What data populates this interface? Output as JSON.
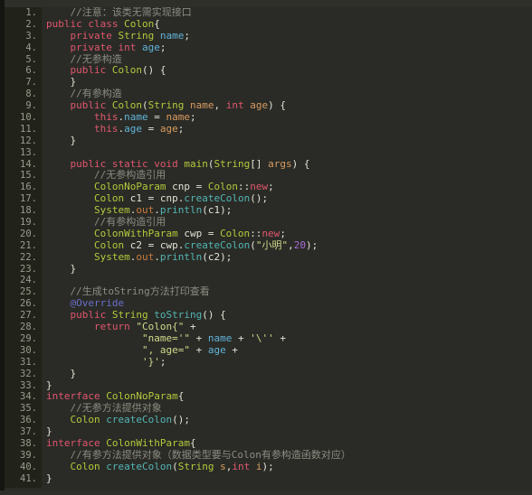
{
  "editor": {
    "name": "java-code-editor",
    "background": "#2a2b26",
    "gutter_background": "#212219",
    "line_count": 41,
    "language": "Java",
    "colors": {
      "keyword": "#e0566e",
      "class_name": "#b5c83c",
      "field": "#62b4da",
      "parameter": "#d79b60",
      "string": "#d2d98c",
      "number": "#a96ed6",
      "method": "#54b5b5",
      "comment": "#8c8c82",
      "annotation": "#6a6fcb",
      "static_field": "#c97a3e",
      "default_text": "#e2e2d6"
    }
  },
  "line_numbers": [
    "1.",
    "2.",
    "3.",
    "4.",
    "5.",
    "6.",
    "7.",
    "8.",
    "9.",
    "10.",
    "11.",
    "12.",
    "13.",
    "14.",
    "15.",
    "16.",
    "17.",
    "18.",
    "19.",
    "20.",
    "21.",
    "22.",
    "23.",
    "24.",
    "25.",
    "26.",
    "27.",
    "28.",
    "29.",
    "30.",
    "31.",
    "32.",
    "33.",
    "34.",
    "35.",
    "36.",
    "37.",
    "38.",
    "39.",
    "40.",
    "41."
  ],
  "lines": [
    {
      "n": 1,
      "tokens": [
        {
          "t": "    ",
          "c": "def"
        },
        {
          "t": "//注意：该类无需实现接口",
          "c": "cmt"
        }
      ]
    },
    {
      "n": 2,
      "tokens": [
        {
          "t": "",
          "c": "def"
        },
        {
          "t": "public ",
          "c": "kw"
        },
        {
          "t": "class ",
          "c": "kw"
        },
        {
          "t": "Colon",
          "c": "cls"
        },
        {
          "t": "{",
          "c": "punc"
        }
      ]
    },
    {
      "n": 3,
      "tokens": [
        {
          "t": "    ",
          "c": "def"
        },
        {
          "t": "private ",
          "c": "kw"
        },
        {
          "t": "String",
          "c": "cls"
        },
        {
          "t": " ",
          "c": "def"
        },
        {
          "t": "name",
          "c": "fld"
        },
        {
          "t": ";",
          "c": "punc"
        }
      ]
    },
    {
      "n": 4,
      "tokens": [
        {
          "t": "    ",
          "c": "def"
        },
        {
          "t": "private ",
          "c": "kw"
        },
        {
          "t": "int",
          "c": "kw"
        },
        {
          "t": " ",
          "c": "def"
        },
        {
          "t": "age",
          "c": "fld"
        },
        {
          "t": ";",
          "c": "punc"
        }
      ]
    },
    {
      "n": 5,
      "tokens": [
        {
          "t": "    ",
          "c": "def"
        },
        {
          "t": "//无参构造",
          "c": "cmt"
        }
      ]
    },
    {
      "n": 6,
      "tokens": [
        {
          "t": "    ",
          "c": "def"
        },
        {
          "t": "public ",
          "c": "kw"
        },
        {
          "t": "Colon",
          "c": "cls"
        },
        {
          "t": "() {",
          "c": "punc"
        }
      ]
    },
    {
      "n": 7,
      "tokens": [
        {
          "t": "    }",
          "c": "punc"
        }
      ]
    },
    {
      "n": 8,
      "tokens": [
        {
          "t": "    ",
          "c": "def"
        },
        {
          "t": "//有参构造",
          "c": "cmt"
        }
      ]
    },
    {
      "n": 9,
      "tokens": [
        {
          "t": "    ",
          "c": "def"
        },
        {
          "t": "public ",
          "c": "kw"
        },
        {
          "t": "Colon",
          "c": "cls"
        },
        {
          "t": "(",
          "c": "punc"
        },
        {
          "t": "String",
          "c": "cls"
        },
        {
          "t": " ",
          "c": "def"
        },
        {
          "t": "name",
          "c": "par"
        },
        {
          "t": ", ",
          "c": "punc"
        },
        {
          "t": "int",
          "c": "kw"
        },
        {
          "t": " ",
          "c": "def"
        },
        {
          "t": "age",
          "c": "par"
        },
        {
          "t": ") {",
          "c": "punc"
        }
      ]
    },
    {
      "n": 10,
      "tokens": [
        {
          "t": "        ",
          "c": "def"
        },
        {
          "t": "this",
          "c": "kw"
        },
        {
          "t": ".",
          "c": "punc"
        },
        {
          "t": "name",
          "c": "fld"
        },
        {
          "t": " = ",
          "c": "punc"
        },
        {
          "t": "name",
          "c": "par"
        },
        {
          "t": ";",
          "c": "punc"
        }
      ]
    },
    {
      "n": 11,
      "tokens": [
        {
          "t": "        ",
          "c": "def"
        },
        {
          "t": "this",
          "c": "kw"
        },
        {
          "t": ".",
          "c": "punc"
        },
        {
          "t": "age",
          "c": "fld"
        },
        {
          "t": " = ",
          "c": "punc"
        },
        {
          "t": "age",
          "c": "par"
        },
        {
          "t": ";",
          "c": "punc"
        }
      ]
    },
    {
      "n": 12,
      "tokens": [
        {
          "t": "    }",
          "c": "punc"
        }
      ]
    },
    {
      "n": 13,
      "tokens": []
    },
    {
      "n": 14,
      "tokens": [
        {
          "t": "    ",
          "c": "def"
        },
        {
          "t": "public static void ",
          "c": "kw"
        },
        {
          "t": "main",
          "c": "cls"
        },
        {
          "t": "(",
          "c": "punc"
        },
        {
          "t": "String",
          "c": "cls"
        },
        {
          "t": "[] ",
          "c": "punc"
        },
        {
          "t": "args",
          "c": "par"
        },
        {
          "t": ") {",
          "c": "punc"
        }
      ]
    },
    {
      "n": 15,
      "tokens": [
        {
          "t": "        ",
          "c": "def"
        },
        {
          "t": "//无参构造引用",
          "c": "cmt"
        }
      ]
    },
    {
      "n": 16,
      "tokens": [
        {
          "t": "        ",
          "c": "def"
        },
        {
          "t": "ColonNoParam",
          "c": "cls"
        },
        {
          "t": " cnp = ",
          "c": "punc"
        },
        {
          "t": "Colon",
          "c": "cls"
        },
        {
          "t": "::",
          "c": "punc"
        },
        {
          "t": "new",
          "c": "kw"
        },
        {
          "t": ";",
          "c": "punc"
        }
      ]
    },
    {
      "n": 17,
      "tokens": [
        {
          "t": "        ",
          "c": "def"
        },
        {
          "t": "Colon",
          "c": "cls"
        },
        {
          "t": " c1 = cnp.",
          "c": "punc"
        },
        {
          "t": "createColon",
          "c": "mth"
        },
        {
          "t": "();",
          "c": "punc"
        }
      ]
    },
    {
      "n": 18,
      "tokens": [
        {
          "t": "        ",
          "c": "def"
        },
        {
          "t": "System",
          "c": "cls"
        },
        {
          "t": ".",
          "c": "punc"
        },
        {
          "t": "out",
          "c": "stat"
        },
        {
          "t": ".",
          "c": "punc"
        },
        {
          "t": "println",
          "c": "mth"
        },
        {
          "t": "(c1);",
          "c": "punc"
        }
      ]
    },
    {
      "n": 19,
      "tokens": [
        {
          "t": "        ",
          "c": "def"
        },
        {
          "t": "//有参构造引用",
          "c": "cmt"
        }
      ]
    },
    {
      "n": 20,
      "tokens": [
        {
          "t": "        ",
          "c": "def"
        },
        {
          "t": "ColonWithParam",
          "c": "cls"
        },
        {
          "t": " cwp = ",
          "c": "punc"
        },
        {
          "t": "Colon",
          "c": "cls"
        },
        {
          "t": "::",
          "c": "punc"
        },
        {
          "t": "new",
          "c": "kw"
        },
        {
          "t": ";",
          "c": "punc"
        }
      ]
    },
    {
      "n": 21,
      "tokens": [
        {
          "t": "        ",
          "c": "def"
        },
        {
          "t": "Colon",
          "c": "cls"
        },
        {
          "t": " c2 = cwp.",
          "c": "punc"
        },
        {
          "t": "createColon",
          "c": "mth"
        },
        {
          "t": "(",
          "c": "punc"
        },
        {
          "t": "\"小明\"",
          "c": "str"
        },
        {
          "t": ",",
          "c": "punc"
        },
        {
          "t": "20",
          "c": "num"
        },
        {
          "t": ");",
          "c": "punc"
        }
      ]
    },
    {
      "n": 22,
      "tokens": [
        {
          "t": "        ",
          "c": "def"
        },
        {
          "t": "System",
          "c": "cls"
        },
        {
          "t": ".",
          "c": "punc"
        },
        {
          "t": "out",
          "c": "stat"
        },
        {
          "t": ".",
          "c": "punc"
        },
        {
          "t": "println",
          "c": "mth"
        },
        {
          "t": "(c2);",
          "c": "punc"
        }
      ]
    },
    {
      "n": 23,
      "tokens": [
        {
          "t": "    }",
          "c": "punc"
        }
      ]
    },
    {
      "n": 24,
      "tokens": []
    },
    {
      "n": 25,
      "tokens": [
        {
          "t": "    ",
          "c": "def"
        },
        {
          "t": "//生成toString方法打印查看",
          "c": "cmt"
        }
      ]
    },
    {
      "n": 26,
      "tokens": [
        {
          "t": "    ",
          "c": "def"
        },
        {
          "t": "@Override",
          "c": "ann"
        }
      ]
    },
    {
      "n": 27,
      "tokens": [
        {
          "t": "    ",
          "c": "def"
        },
        {
          "t": "public ",
          "c": "kw"
        },
        {
          "t": "String",
          "c": "cls"
        },
        {
          "t": " ",
          "c": "def"
        },
        {
          "t": "toString",
          "c": "mth"
        },
        {
          "t": "() {",
          "c": "punc"
        }
      ]
    },
    {
      "n": 28,
      "tokens": [
        {
          "t": "        ",
          "c": "def"
        },
        {
          "t": "return ",
          "c": "kw"
        },
        {
          "t": "\"Colon{\"",
          "c": "str"
        },
        {
          "t": " +",
          "c": "punc"
        }
      ]
    },
    {
      "n": 29,
      "tokens": [
        {
          "t": "                ",
          "c": "def"
        },
        {
          "t": "\"name='\"",
          "c": "str"
        },
        {
          "t": " + ",
          "c": "punc"
        },
        {
          "t": "name",
          "c": "fld"
        },
        {
          "t": " + ",
          "c": "punc"
        },
        {
          "t": "'\\''",
          "c": "str"
        },
        {
          "t": " +",
          "c": "punc"
        }
      ]
    },
    {
      "n": 30,
      "tokens": [
        {
          "t": "                ",
          "c": "def"
        },
        {
          "t": "\", age=\"",
          "c": "str"
        },
        {
          "t": " + ",
          "c": "punc"
        },
        {
          "t": "age",
          "c": "fld"
        },
        {
          "t": " +",
          "c": "punc"
        }
      ]
    },
    {
      "n": 31,
      "tokens": [
        {
          "t": "                ",
          "c": "def"
        },
        {
          "t": "'}'",
          "c": "str"
        },
        {
          "t": ";",
          "c": "punc"
        }
      ]
    },
    {
      "n": 32,
      "tokens": [
        {
          "t": "    }",
          "c": "punc"
        }
      ]
    },
    {
      "n": 33,
      "tokens": [
        {
          "t": "}",
          "c": "punc"
        }
      ]
    },
    {
      "n": 34,
      "tokens": [
        {
          "t": "",
          "c": "def"
        },
        {
          "t": "interface ",
          "c": "kw"
        },
        {
          "t": "ColonNoParam",
          "c": "cls"
        },
        {
          "t": "{",
          "c": "punc"
        }
      ]
    },
    {
      "n": 35,
      "tokens": [
        {
          "t": "    ",
          "c": "def"
        },
        {
          "t": "//无参方法提供对象",
          "c": "cmt"
        }
      ]
    },
    {
      "n": 36,
      "tokens": [
        {
          "t": "    ",
          "c": "def"
        },
        {
          "t": "Colon",
          "c": "cls"
        },
        {
          "t": " ",
          "c": "def"
        },
        {
          "t": "createColon",
          "c": "mth"
        },
        {
          "t": "();",
          "c": "punc"
        }
      ]
    },
    {
      "n": 37,
      "tokens": [
        {
          "t": "}",
          "c": "punc"
        }
      ]
    },
    {
      "n": 38,
      "tokens": [
        {
          "t": "",
          "c": "def"
        },
        {
          "t": "interface ",
          "c": "kw"
        },
        {
          "t": "ColonWithParam",
          "c": "cls"
        },
        {
          "t": "{",
          "c": "punc"
        }
      ]
    },
    {
      "n": 39,
      "tokens": [
        {
          "t": "    ",
          "c": "def"
        },
        {
          "t": "//有参方法提供对象（数据类型要与Colon有参构造函数对应）",
          "c": "cmt"
        }
      ]
    },
    {
      "n": 40,
      "tokens": [
        {
          "t": "    ",
          "c": "def"
        },
        {
          "t": "Colon",
          "c": "cls"
        },
        {
          "t": " ",
          "c": "def"
        },
        {
          "t": "createColon",
          "c": "mth"
        },
        {
          "t": "(",
          "c": "punc"
        },
        {
          "t": "String",
          "c": "cls"
        },
        {
          "t": " ",
          "c": "def"
        },
        {
          "t": "s",
          "c": "par"
        },
        {
          "t": ",",
          "c": "punc"
        },
        {
          "t": "int",
          "c": "kw"
        },
        {
          "t": " ",
          "c": "def"
        },
        {
          "t": "i",
          "c": "par"
        },
        {
          "t": ");",
          "c": "punc"
        }
      ]
    },
    {
      "n": 41,
      "tokens": [
        {
          "t": "}",
          "c": "punc"
        }
      ]
    }
  ]
}
